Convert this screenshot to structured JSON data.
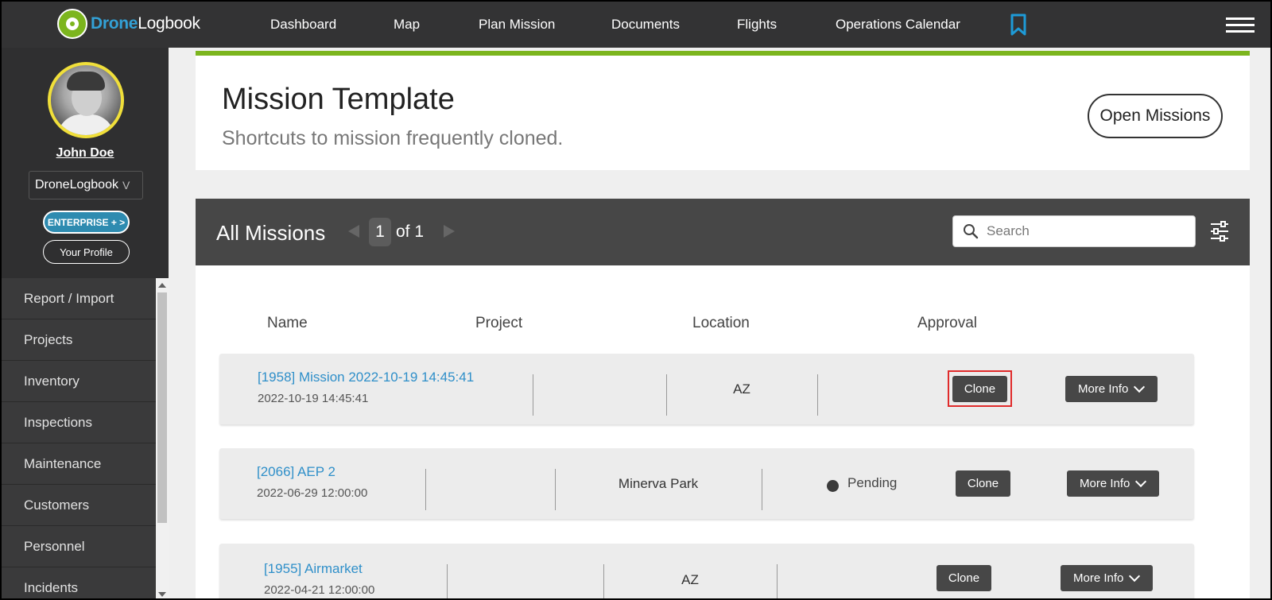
{
  "app": {
    "logo_part1": "Drone",
    "logo_part2": "Logbook"
  },
  "nav": {
    "items": [
      "Dashboard",
      "Map",
      "Plan Mission",
      "Documents",
      "Flights",
      "Operations Calendar"
    ]
  },
  "user": {
    "name": "John Doe",
    "org": "DroneLogbook",
    "org_chevron": "V",
    "plan_badge": "ENTERPRISE + >",
    "profile_button": "Your Profile"
  },
  "sidebar": {
    "items": [
      "Report / Import",
      "Projects",
      "Inventory",
      "Inspections",
      "Maintenance",
      "Customers",
      "Personnel",
      "Incidents"
    ]
  },
  "template": {
    "title": "Mission Template",
    "subtitle": "Shortcuts to mission frequently cloned.",
    "open_button": "Open Missions"
  },
  "missions": {
    "title": "All Missions",
    "page_current": "1",
    "page_of": "of 1",
    "search_placeholder": "Search",
    "columns": [
      "Name",
      "Project",
      "Location",
      "Approval"
    ],
    "clone_label": "Clone",
    "more_label": "More Info",
    "rows": [
      {
        "name": "[1958] Mission 2022-10-19 14:45:41",
        "date": "2022-10-19 14:45:41",
        "project": "",
        "location": "AZ",
        "approval": ""
      },
      {
        "name": "[2066] AEP 2",
        "date": "2022-06-29 12:00:00",
        "project": "",
        "location": "Minerva Park",
        "approval": "Pending"
      },
      {
        "name": "[1955] Airmarket",
        "date": "2022-04-21 12:00:00",
        "project": "",
        "location": "AZ",
        "approval": ""
      }
    ]
  },
  "colors": {
    "nav_bg": "#333334",
    "accent_green": "#7cb51e",
    "link_blue": "#2f8fc9",
    "bookmark_blue": "#1e9bd7",
    "highlight_red": "#e02b2b"
  }
}
